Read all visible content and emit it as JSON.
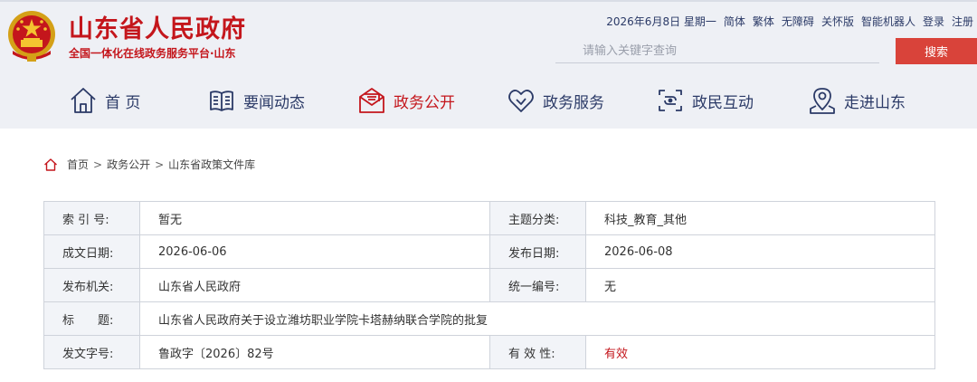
{
  "header": {
    "title": "山东省人民政府",
    "subtitle": "全国一体化在线政务服务平台·山东"
  },
  "toplinks": {
    "date": "2026年6月8日 星期一",
    "items": [
      "简体",
      "繁体",
      "无障碍",
      "关怀版",
      "智能机器人",
      "登录",
      "注册"
    ]
  },
  "search": {
    "placeholder": "请输入关键字查询",
    "button": "搜索"
  },
  "nav": {
    "items": [
      {
        "label": "首 页",
        "icon": "home-icon"
      },
      {
        "label": "要闻动态",
        "icon": "book-icon"
      },
      {
        "label": "政务公开",
        "icon": "mail-icon"
      },
      {
        "label": "政务服务",
        "icon": "heart-icon"
      },
      {
        "label": "政民互动",
        "icon": "interact-icon"
      },
      {
        "label": "走进山东",
        "icon": "location-icon"
      }
    ],
    "active_index": 2
  },
  "breadcrumb": {
    "items": [
      "首页",
      "政务公开",
      "山东省政策文件库"
    ],
    "separator": ">"
  },
  "meta": {
    "index_no": {
      "label": "索 引 号:",
      "value": "暂无"
    },
    "topic": {
      "label": "主题分类:",
      "value": "科技_教育_其他"
    },
    "written_date": {
      "label": "成文日期:",
      "value": "2026-06-06"
    },
    "publish_date": {
      "label": "发布日期:",
      "value": "2026-06-08"
    },
    "issuer": {
      "label": "发布机关:",
      "value": "山东省人民政府"
    },
    "unified_no": {
      "label": "统一编号:",
      "value": "无"
    },
    "title": {
      "label": "标　　题:",
      "value": "山东省人民政府关于设立潍坊职业学院卡塔赫纳联合学院的批复"
    },
    "doc_no": {
      "label": "发文字号:",
      "value": "鲁政字〔2026〕82号"
    },
    "validity": {
      "label": "有 效 性:",
      "value": "有效"
    }
  },
  "colors": {
    "brand_red": "#c4161c",
    "nav_text": "#2b3a67",
    "search_button": "#d9433a",
    "header_bg": "#eef0f5"
  }
}
